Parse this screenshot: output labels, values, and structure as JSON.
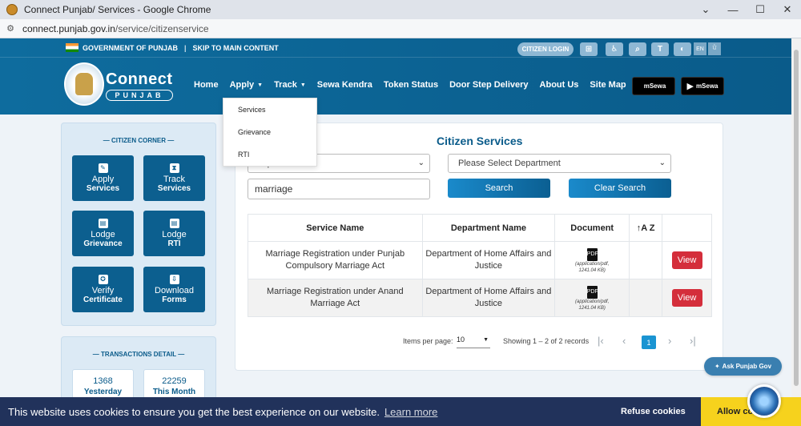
{
  "browser": {
    "title": "Connect Punjab/ Services - Google Chrome",
    "url_host": "connect.punjab.gov.in",
    "url_path": "/service/citizenservice"
  },
  "header": {
    "gov_label": "GOVERNMENT OF PUNJAB",
    "skip_label": "SKIP TO MAIN CONTENT",
    "citizen_login": "CITIZEN LOGIN",
    "lang_en": "EN",
    "lang_pa": "ਪੰ",
    "brand_top": "Connect",
    "brand_bottom": "PUNJAB",
    "nav": {
      "home": "Home",
      "apply": "Apply",
      "track": "Track",
      "sewa_kendra": "Sewa Kendra",
      "token_status": "Token Status",
      "door_step": "Door Step Delivery",
      "about": "About Us",
      "site_map": "Site Map"
    },
    "store_ios": "mSewa",
    "store_android": "mSewa"
  },
  "dropdown": {
    "services": "Services",
    "grievance": "Grievance",
    "rti": "RTI"
  },
  "citizen_corner": {
    "title": "CITIZEN CORNER",
    "tiles": [
      {
        "l1": "Apply",
        "l2": "Services"
      },
      {
        "l1": "Track",
        "l2": "Services"
      },
      {
        "l1": "Lodge",
        "l2": "Grievance"
      },
      {
        "l1": "Lodge",
        "l2": "RTI"
      },
      {
        "l1": "Verify",
        "l2": "Certificate"
      },
      {
        "l1": "Download",
        "l2": "Forms"
      }
    ]
  },
  "transactions": {
    "title": "TRANSACTIONS DETAIL",
    "yesterday_value": "1368",
    "yesterday_label": "Yesterday",
    "month_value": "22259",
    "month_label": "This Month"
  },
  "search": {
    "title": "Citizen Services",
    "services_select": "Top Services",
    "department_select": "Please Select Department",
    "query": "marriage",
    "search_button": "Search",
    "clear_button": "Clear Search"
  },
  "table": {
    "headers": {
      "service": "Service Name",
      "department": "Department Name",
      "document": "Document",
      "sort": "↑A Z",
      "action": ""
    },
    "rows": [
      {
        "service": "Marriage Registration under Punjab Compulsory Marriage Act",
        "department": "Department of Home Affairs and Justice",
        "doc_type": "(application/pdf,",
        "doc_size": "1241.04 KB)",
        "action": "View"
      },
      {
        "service": "Marriage Registration under Anand Marriage Act",
        "department": "Department of Home Affairs and Justice",
        "doc_type": "(application/pdf,",
        "doc_size": "1241.04 KB)",
        "action": "View"
      }
    ]
  },
  "pagination": {
    "items_per_page_label": "Items per page:",
    "items_per_page_value": "10",
    "range_label": "Showing 1 – 2 of 2 records",
    "current_page": "1"
  },
  "ask_button": "Ask Punjab Gov",
  "cookie": {
    "message": "This website uses cookies to ensure you get the best experience on our website.",
    "learn_more": "Learn more",
    "refuse": "Refuse cookies",
    "allow": "Allow cookies"
  }
}
